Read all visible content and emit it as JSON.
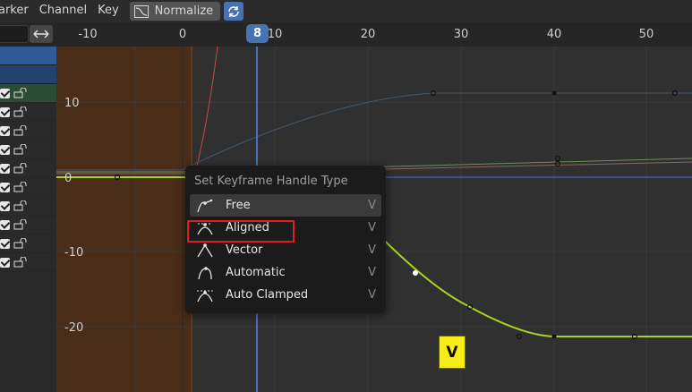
{
  "menubar": {
    "items": [
      "arker",
      "Channel",
      "Key"
    ],
    "normalize_label": "Normalize"
  },
  "ruler": {
    "ticks": [
      "-10",
      "0",
      "10",
      "20",
      "30",
      "40",
      "50"
    ],
    "current_frame": "8"
  },
  "y_axis": {
    "labels": [
      "10",
      "0",
      "-10",
      "-20"
    ]
  },
  "context_menu": {
    "title": "Set Keyframe Handle Type",
    "items": [
      {
        "label": "Free",
        "hotkey": "V",
        "icon": "handle-free-icon"
      },
      {
        "label": "Aligned",
        "hotkey": "V",
        "icon": "handle-aligned-icon"
      },
      {
        "label": "Vector",
        "hotkey": "V",
        "icon": "handle-vector-icon"
      },
      {
        "label": "Automatic",
        "hotkey": "V",
        "icon": "handle-automatic-icon"
      },
      {
        "label": "Auto Clamped",
        "hotkey": "V",
        "icon": "handle-auto-clamped-icon"
      }
    ]
  },
  "key_badge": "V",
  "colors": {
    "accent": "#4772b3",
    "highlight_box": "#e21d1d",
    "badge": "#f6ec16",
    "curve_selected": "#a8d420",
    "preview_range": "#4a2d19"
  }
}
